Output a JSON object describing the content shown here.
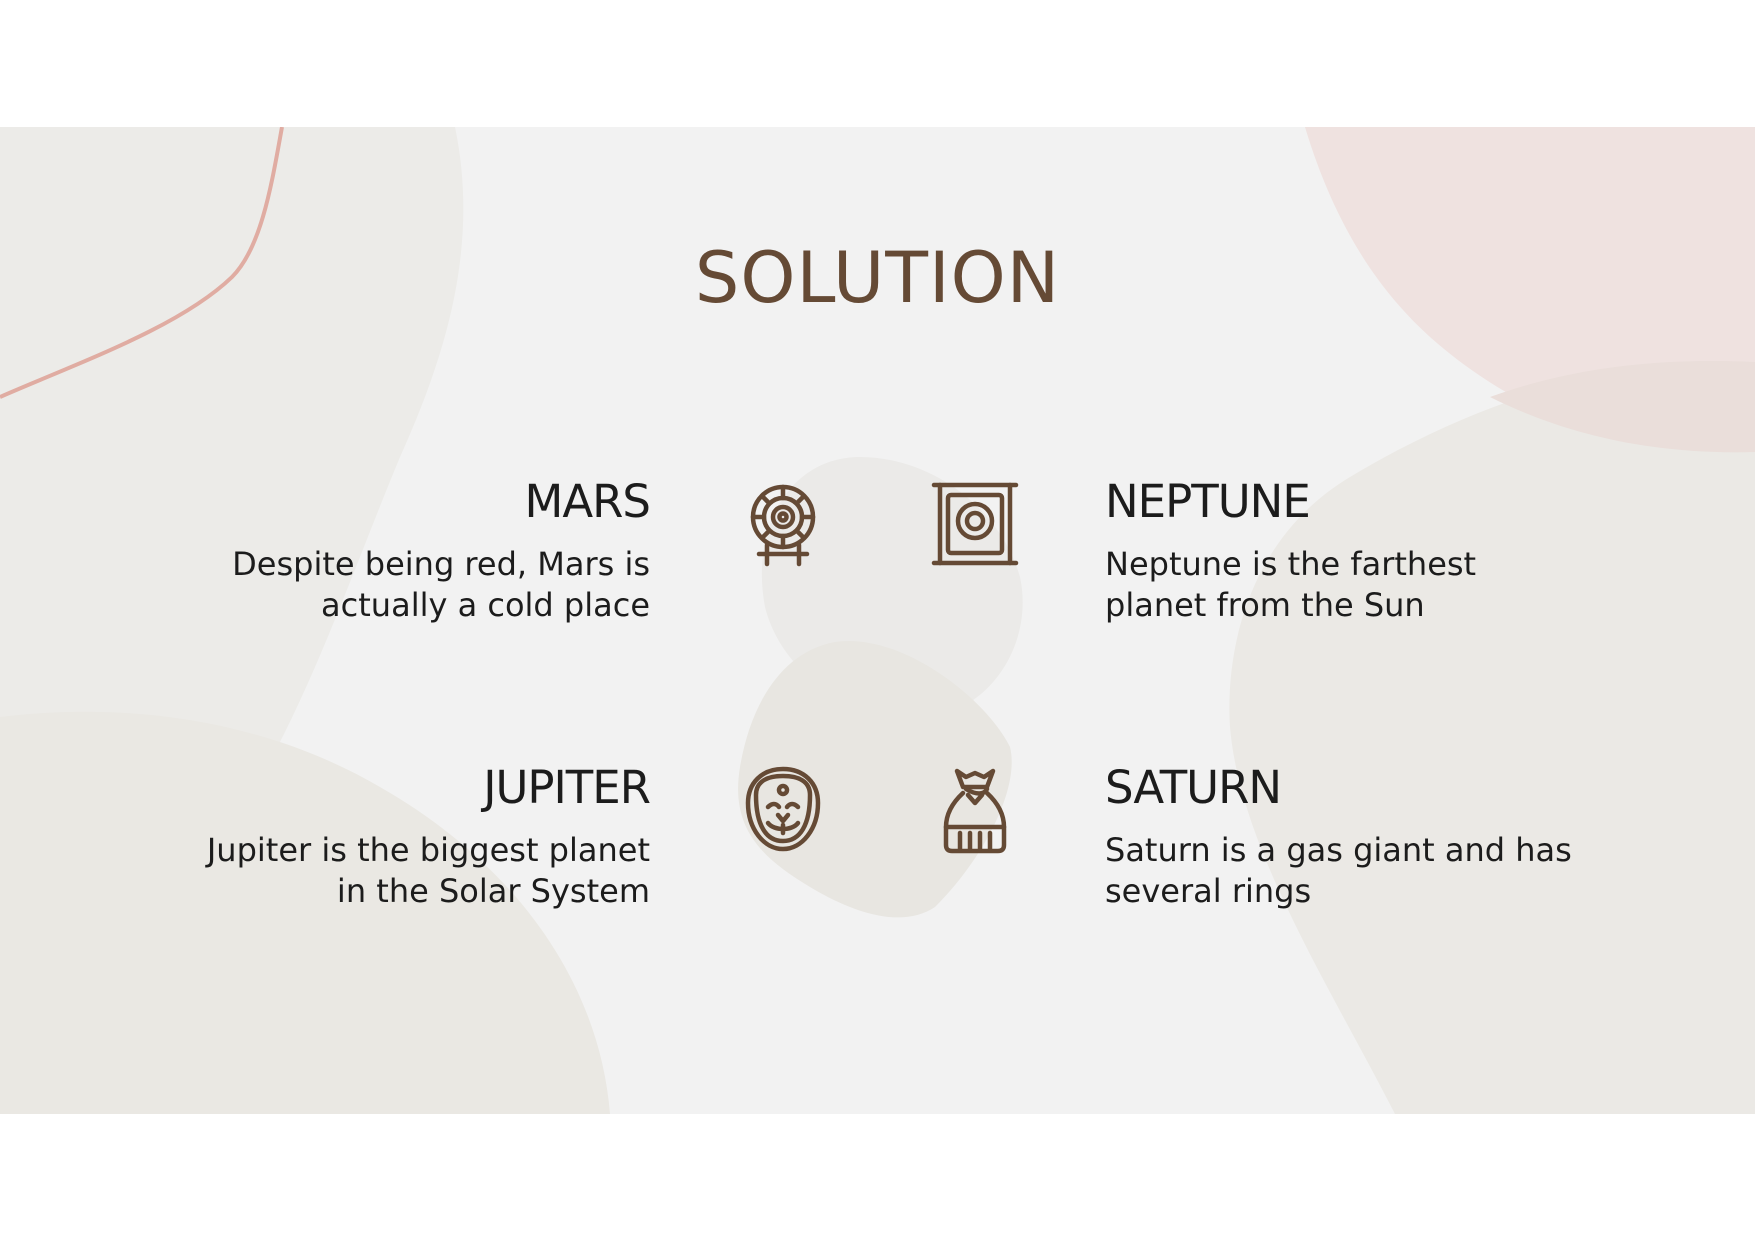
{
  "slide": {
    "title": "SOLUTION"
  },
  "items": {
    "mars": {
      "heading": "MARS",
      "text_line1": "Despite being red, Mars is",
      "text_line2": "actually a cold place",
      "icon": "gong-target-icon"
    },
    "neptune": {
      "heading": "NEPTUNE",
      "text_line1": "Neptune is the farthest",
      "text_line2": "planet from the Sun",
      "icon": "framed-gong-icon"
    },
    "jupiter": {
      "heading": "JUPITER",
      "text_line1": "Jupiter is the biggest planet",
      "text_line2": "in the Solar System",
      "icon": "mask-face-icon"
    },
    "saturn": {
      "heading": "SATURN",
      "text_line1": "Saturn is a gas giant and has",
      "text_line2": "several rings",
      "icon": "money-bag-icon"
    }
  },
  "colors": {
    "title": "#654a35",
    "icon": "#654a35",
    "text": "#1c1c1c",
    "slide_bg": "#f2f2f2",
    "blob_beige": "#e9e7e2",
    "blob_pink": "#eedfdc",
    "accent_line": "#e0aca2"
  }
}
